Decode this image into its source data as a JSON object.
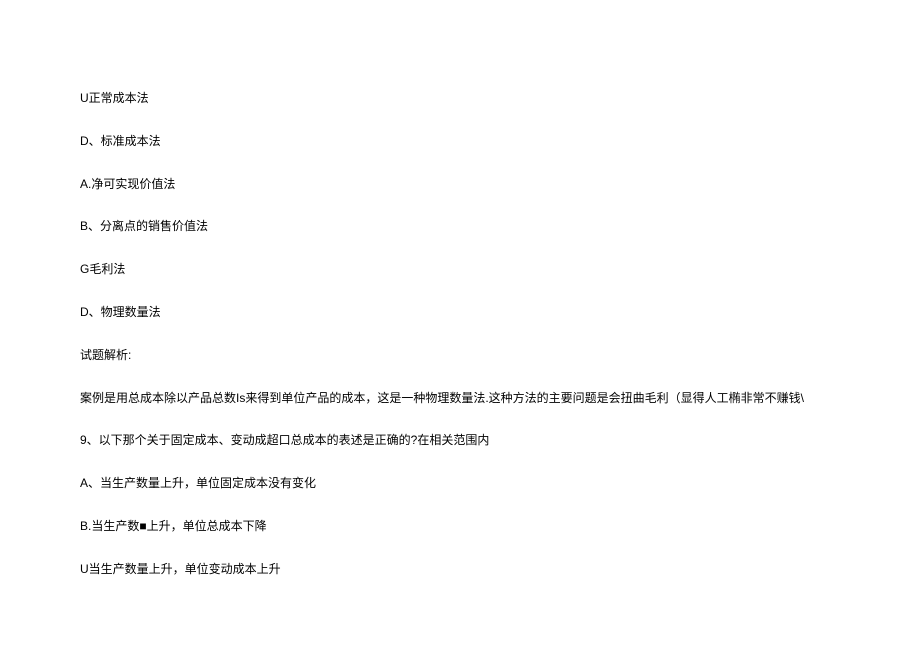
{
  "lines": [
    "U正常成本法",
    "D、标准成本法",
    "A.净可实现价值法",
    "B、分离点的销售价值法",
    "G毛利法",
    "D、物理数量法",
    "试题解析:",
    "案例是用总成本除以产品总数Is来得到单位产品的成本，这是一种物理数量法.这种方法的主要问题是会扭曲毛利（显得人工椭非常不赚钱\\",
    "9、以下那个关于固定成本、变动成超口总成本的表述是正确的?在相关范围内",
    "A、当生产数量上升，单位固定成本没有变化",
    "B.当生产数■上升，单位总成本下降",
    "U当生产数量上升，单位变动成本上升"
  ]
}
